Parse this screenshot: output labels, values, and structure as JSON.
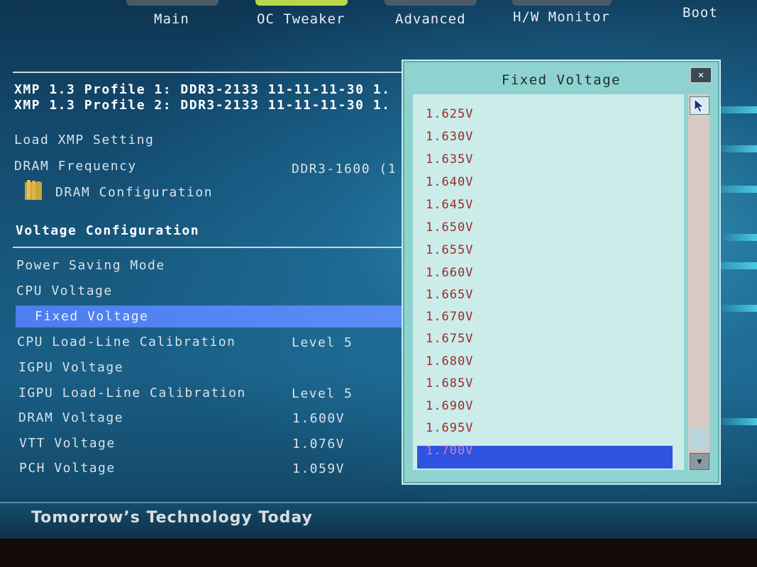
{
  "tabs": [
    "Main",
    "OC Tweaker",
    "Advanced",
    "H/W Monitor",
    "Boot"
  ],
  "active_tab": "OC Tweaker",
  "xmp": {
    "profile1": "XMP 1.3 Profile 1: DDR3-2133 11-11-11-30 1.",
    "profile2": "XMP 1.3 Profile 2: DDR3-2133 11-11-11-30 1."
  },
  "settings": {
    "load_xmp": "Load XMP Setting",
    "dram_frequency_label": "DRAM Frequency",
    "dram_frequency_value": "DDR3-1600 (1",
    "dram_configuration": "DRAM Configuration",
    "voltage_configuration": "Voltage Configuration",
    "power_saving_mode": "Power Saving Mode",
    "cpu_voltage": "CPU Voltage",
    "fixed_voltage": "Fixed Voltage",
    "cpu_llc_label": "CPU Load-Line Calibration",
    "cpu_llc_value": "Level 5",
    "igpu_voltage": "IGPU Voltage",
    "igpu_llc_label": "IGPU Load-Line Calibration",
    "igpu_llc_value": "Level 5",
    "dram_voltage_label": "DRAM Voltage",
    "dram_voltage_value": "1.600V",
    "vtt_voltage_label": "VTT Voltage",
    "vtt_voltage_value": "1.076V",
    "pch_voltage_label": "PCH Voltage",
    "pch_voltage_value": "1.059V"
  },
  "popup": {
    "title": "Fixed Voltage",
    "close_label": "✕",
    "options": [
      "1.625V",
      "1.630V",
      "1.635V",
      "1.640V",
      "1.645V",
      "1.650V",
      "1.655V",
      "1.660V",
      "1.665V",
      "1.670V",
      "1.675V",
      "1.680V",
      "1.685V",
      "1.690V",
      "1.695V",
      "1.700V"
    ],
    "selected": "1.700V"
  },
  "footer": {
    "slogan": "Tomorrow’s Technology Today"
  },
  "colors": {
    "accent_tab": "#b9d94a",
    "selection": "#4d7df0",
    "popup_bg": "#8fd3d0"
  }
}
